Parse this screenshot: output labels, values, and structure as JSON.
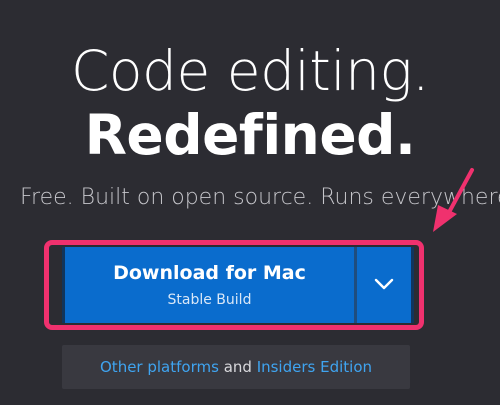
{
  "hero": {
    "headline_line1": "Code editing.",
    "headline_line2": "Redefined.",
    "tagline": "Free. Built on open source. Runs everywhere."
  },
  "download": {
    "title": "Download for Mac",
    "subtitle": "Stable Build",
    "dropdown_icon": "chevron-down-icon"
  },
  "platforms": {
    "other_link": "Other platforms",
    "conjunction": " and ",
    "insiders_link": "Insiders Edition"
  },
  "annotation": {
    "highlight_color": "#f0316e",
    "arrow_icon": "arrow-pointer-icon"
  },
  "colors": {
    "background": "#2c2c32",
    "button_blue": "#0a6ccd",
    "link_blue": "#3fa4f0"
  }
}
